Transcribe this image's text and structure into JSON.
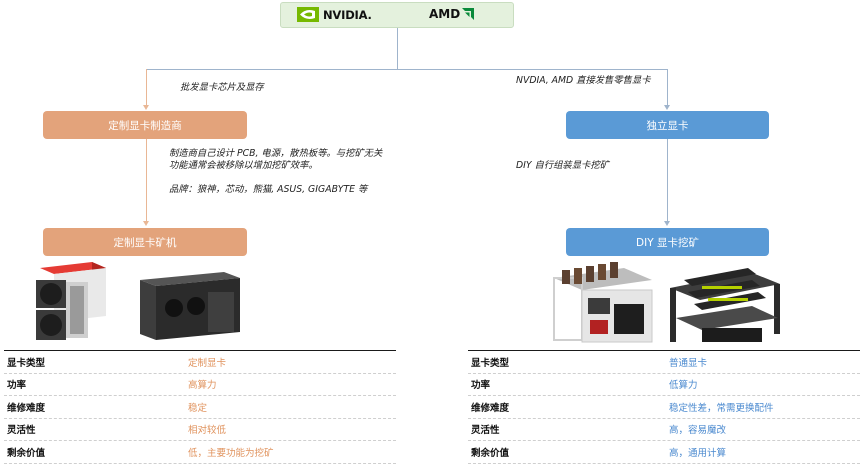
{
  "brands": {
    "nvidia": "NVIDIA.",
    "amd": "AMD"
  },
  "left_branch": {
    "edge_label": "批发显卡芯片及显存",
    "manufacturer_box": "定制显卡制造商",
    "note_line1": "制造商自己设计 PCB, 电源，散热板等。与挖矿无关",
    "note_line2": "功能通常会被移除以增加挖矿效率。",
    "brands_note": "品牌：狼神，芯动，熊猫, ASUS, GIGABYTE 等",
    "miner_box": "定制显卡矿机"
  },
  "right_branch": {
    "edge_label": "NVDIA, AMD 直接发售零售显卡",
    "independent_box": "独立显卡",
    "note": "DIY 自行组装显卡挖矿",
    "diy_box": "DIY 显卡挖矿"
  },
  "left_table": [
    {
      "key": "显卡类型",
      "value": "定制显卡"
    },
    {
      "key": "功率",
      "value": "高算力"
    },
    {
      "key": "维修难度",
      "value": "稳定"
    },
    {
      "key": "灵活性",
      "value": "相对较低"
    },
    {
      "key": "剩余价值",
      "value": "低，主要功能为挖矿"
    }
  ],
  "right_table": [
    {
      "key": "显卡类型",
      "value": "普通显卡"
    },
    {
      "key": "功率",
      "value": "低算力"
    },
    {
      "key": "维修难度",
      "value": "稳定性差，常需更换配件"
    },
    {
      "key": "灵活性",
      "value": "高，容易魔改"
    },
    {
      "key": "剩余价值",
      "value": "高，通用计算"
    }
  ],
  "colors": {
    "orange": "#e3a37b",
    "blue": "#5a9ad6",
    "brand_bg": "#e4f1dd"
  }
}
